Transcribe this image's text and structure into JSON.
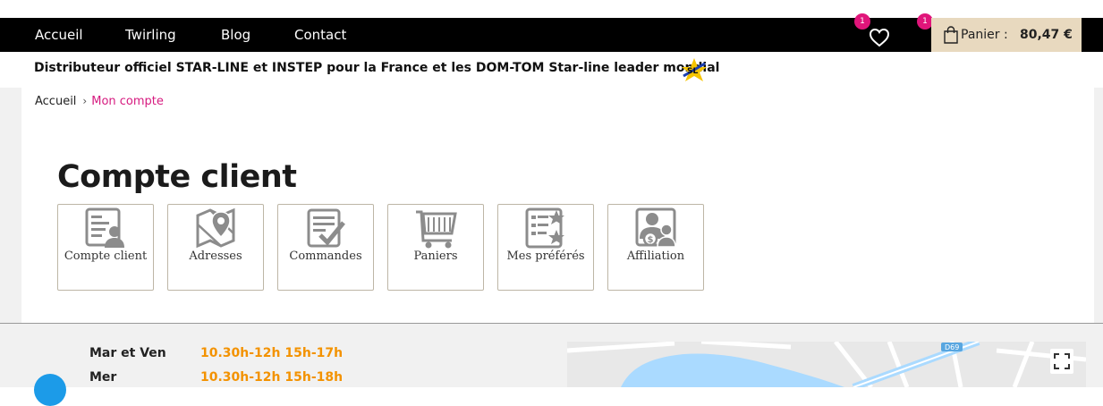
{
  "nav": {
    "items": [
      {
        "label": "Accueil"
      },
      {
        "label": "Twirling"
      },
      {
        "label": "Blog"
      },
      {
        "label": "Contact"
      }
    ],
    "wishlist_count": "1",
    "cart_count": "1",
    "cart_label": "Panier :",
    "cart_total": "80,47 €"
  },
  "banner": {
    "text": "Distributeur officiel STAR-LINE et INSTEP pour la France et les DOM-TOM Star-line leader mondial"
  },
  "breadcrumb": {
    "home": "Accueil",
    "current": "Mon compte"
  },
  "page": {
    "title": "Compte client"
  },
  "tiles": [
    {
      "label": "Compte  client",
      "icon": "user-card-icon"
    },
    {
      "label": "Adresses",
      "icon": "map-pin-icon"
    },
    {
      "label": "Commandes",
      "icon": "clipboard-check-icon"
    },
    {
      "label": "Paniers",
      "icon": "shopping-cart-icon"
    },
    {
      "label": "Mes  préférés",
      "icon": "star-list-icon"
    },
    {
      "label": "Affiliation",
      "icon": "affiliation-icon"
    }
  ],
  "footer": {
    "hours": [
      {
        "day": "Mar et Ven",
        "time": "10.30h-12h 15h-17h"
      },
      {
        "day": "Mer",
        "time": "10.30h-12h 15h-18h"
      }
    ]
  },
  "map": {
    "road_label": "D69"
  },
  "colors": {
    "accent_pink": "#d61a7f",
    "badge_pink": "#e0157a",
    "cart_bg": "#e8d9bf",
    "hours_orange": "#f39200"
  }
}
